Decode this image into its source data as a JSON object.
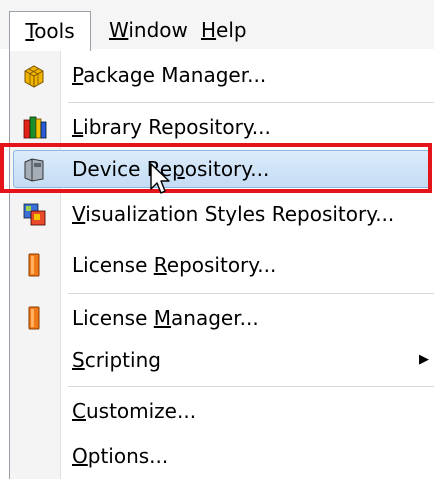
{
  "menubar": {
    "tools": {
      "first": "T",
      "rest": "ools"
    },
    "window": {
      "first": "W",
      "rest": "indow"
    },
    "help": {
      "first": "H",
      "rest": "elp"
    }
  },
  "menu": {
    "items": [
      {
        "pre": "",
        "ul": "P",
        "post": "ackage Manager...",
        "icon": "package-icon"
      },
      {
        "pre": "",
        "ul": "L",
        "post": "ibrary Repository...",
        "icon": "library-icon"
      },
      {
        "pre": "Device Re",
        "ul": "p",
        "post": "ository...",
        "icon": "device-icon",
        "highlighted": true
      },
      {
        "pre": "",
        "ul": "V",
        "post": "isualization Styles Repository...",
        "icon": "visualization-icon"
      },
      {
        "pre": "License ",
        "ul": "R",
        "post": "epository...",
        "icon": "license-icon"
      },
      {
        "pre": "License ",
        "ul": "M",
        "post": "anager...",
        "icon": "license-icon"
      },
      {
        "pre": "",
        "ul": "S",
        "post": "cripting",
        "icon": "",
        "submenu": true
      },
      {
        "pre": "",
        "ul": "C",
        "post": "ustomize...",
        "icon": ""
      },
      {
        "pre": "",
        "ul": "O",
        "post": "ptions...",
        "icon": ""
      }
    ]
  },
  "colors": {
    "highlight_border": "#e5141b",
    "selection": "#c4dcf4"
  }
}
